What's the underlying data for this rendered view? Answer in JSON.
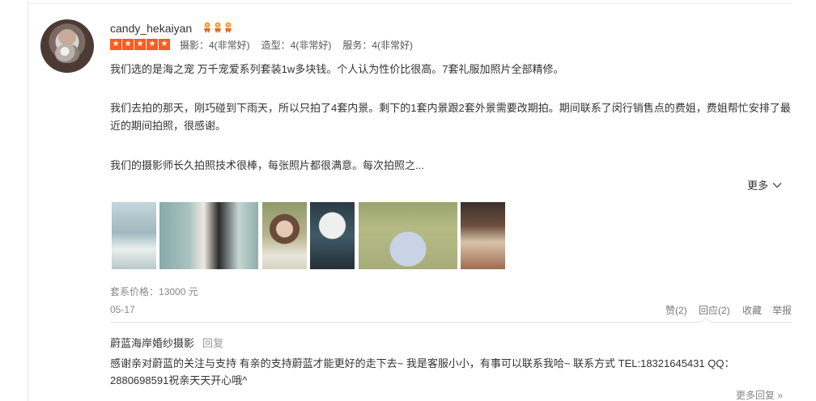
{
  "review": {
    "username": "candy_hekaiyan",
    "crowns": [
      "crown-icon",
      "crown-icon",
      "crown-icon"
    ],
    "stars": 5,
    "ratings": [
      {
        "label": "摄影：4(非常好)"
      },
      {
        "label": "造型：4(非常好)"
      },
      {
        "label": "服务：4(非常好)"
      }
    ],
    "paragraphs": [
      "我们选的是海之宠 万千宠爱系列套装1w多块钱。个人认为性价比很高。7套礼服加照片全部精修。",
      "我们去拍的那天，刚巧碰到下雨天，所以只拍了4套内景。剩下的1套内景跟2套外景需要改期拍。期间联系了闵行销售点的费姐，费姐帮忙安排了最近的期间拍照，很感谢。",
      "我们的摄影师长久拍照技术很棒，每张照片都很满意。每次拍照之..."
    ],
    "more_label": "更多",
    "price_label": "套系价格：",
    "price_value": "13000 元",
    "date": "05-17",
    "actions": {
      "like": "赞(2)",
      "reply": "回应(2)",
      "favorite": "收藏",
      "report": "举报"
    }
  },
  "reply": {
    "author": "蔚蓝海岸婚纱摄影",
    "reply_label": "回复",
    "text": "感谢亲对蔚蓝的关注与支持 有亲的支持蔚蓝才能更好的走下去~ 我是客服小小，有事可以联系我哈~ 联系方式 TEL:18321645431 QQ：2880698591祝亲天天开心哦^"
  },
  "more_replies": "更多回复 »",
  "colors": {
    "star_bg": "#ff5a1f",
    "crown": "#f29a2e"
  }
}
